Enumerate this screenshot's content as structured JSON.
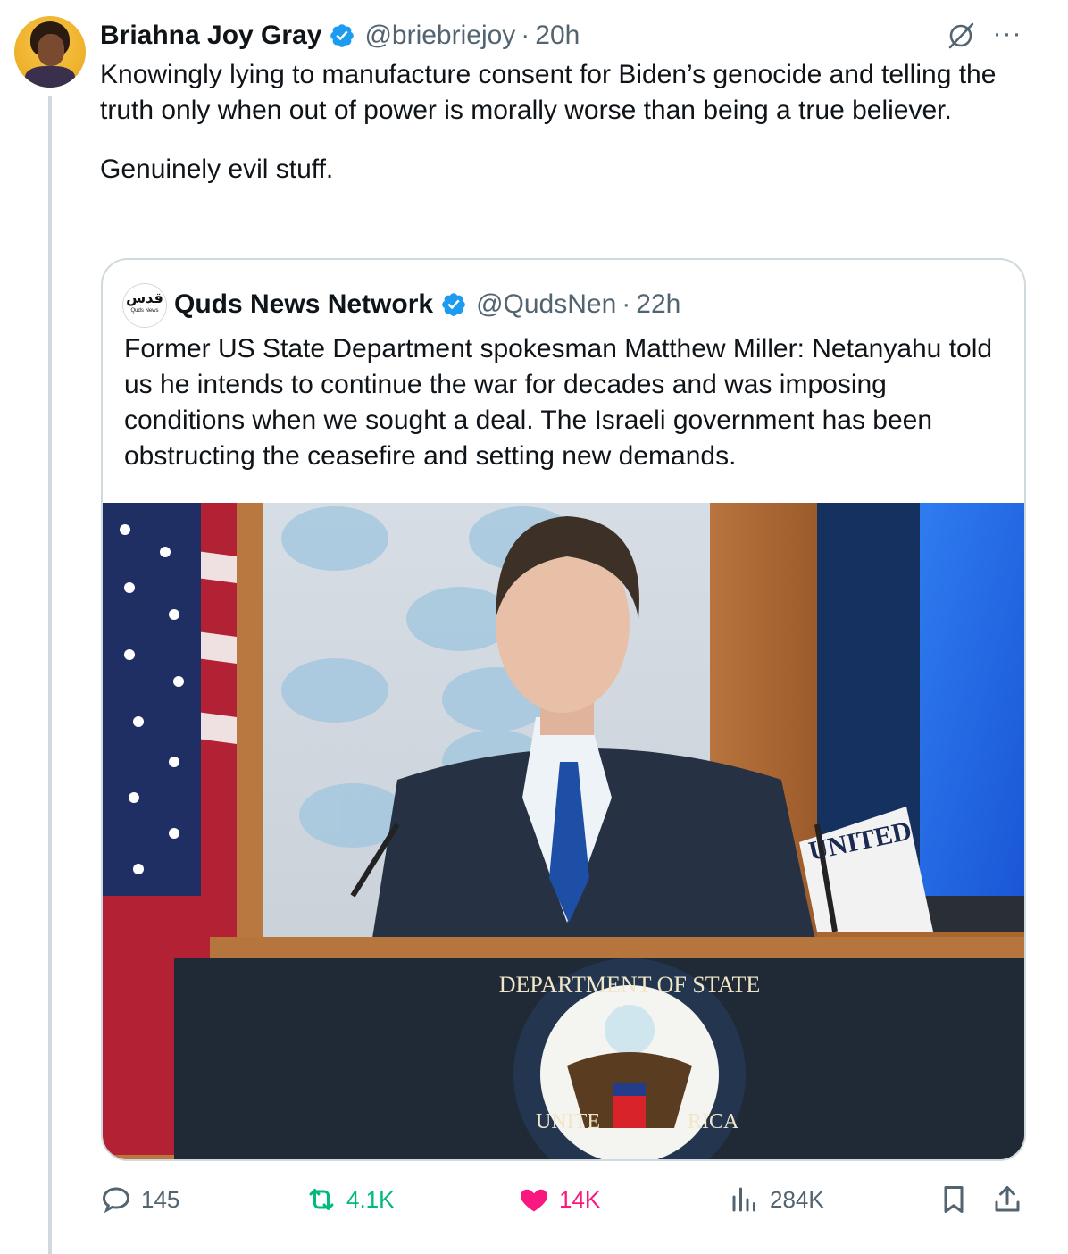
{
  "tweet": {
    "author_name": "Briahna Joy Gray",
    "handle": "@briebriejoy",
    "separator": "·",
    "time": "20h",
    "paragraphs": [
      "Knowingly lying to manufacture consent for Biden’s genocide and telling the truth only when out of power is morally worse than being a true believer.",
      "Genuinely evil stuff."
    ],
    "more_label": "···"
  },
  "quote": {
    "author_name": "Quds News Network",
    "handle": "@QudsNen",
    "separator": "·",
    "time": "22h",
    "text": "Former US State Department spokesman Matthew Miller: Netanyahu told us he intends to continue the war for decades and was imposing conditions when we sought a deal. The Israeli government has been obstructing the ceasefire and setting new demands.",
    "avatar_logo_text": "قدس",
    "avatar_logo_sub": "Quds News",
    "photo": {
      "seal_top_text": "DEPARTMENT OF STATE",
      "seal_left_text": "UNITE",
      "seal_right_text": "RICA",
      "flag_text": "UNITED"
    }
  },
  "actions": {
    "replies": "145",
    "reposts": "4.1K",
    "likes": "14K",
    "views": "284K"
  },
  "colors": {
    "text": "#0f1419",
    "secondary": "#536471",
    "verified": "#1d9bf0",
    "repost_active": "#00ba7c",
    "like_active": "#f91880",
    "border": "#cfd9de"
  }
}
